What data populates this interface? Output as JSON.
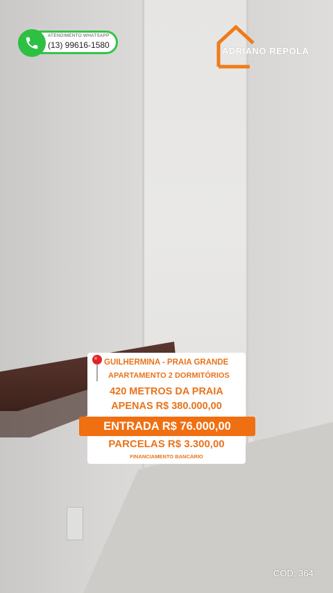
{
  "whatsapp": {
    "label": "ATENDIMENTO WHATSAPP",
    "phone": "(13) 99616-1580",
    "icon": "phone-icon",
    "color": "#32c445"
  },
  "logo": {
    "name": "ADRIANO REPOLA",
    "icon": "house-roof-icon",
    "color": "#f07a1a"
  },
  "listing": {
    "location": "GUILHERMINA  - PRAIA GRANDE",
    "type": "APARTAMENTO 2 DORMITÓRIOS",
    "distance": "420 METROS DA PRAIA",
    "price": "APENAS R$ 380.000,00",
    "entrada": "ENTRADA R$ 76.000,00",
    "parcelas": "PARCELAS R$ 3.300,00",
    "financing": "FINANCIAMENTO BANCÁRIO",
    "pin_icon": "map-pin-icon",
    "accent": "#e8731c",
    "highlight": "#f06f11"
  },
  "code": "COD: 364"
}
